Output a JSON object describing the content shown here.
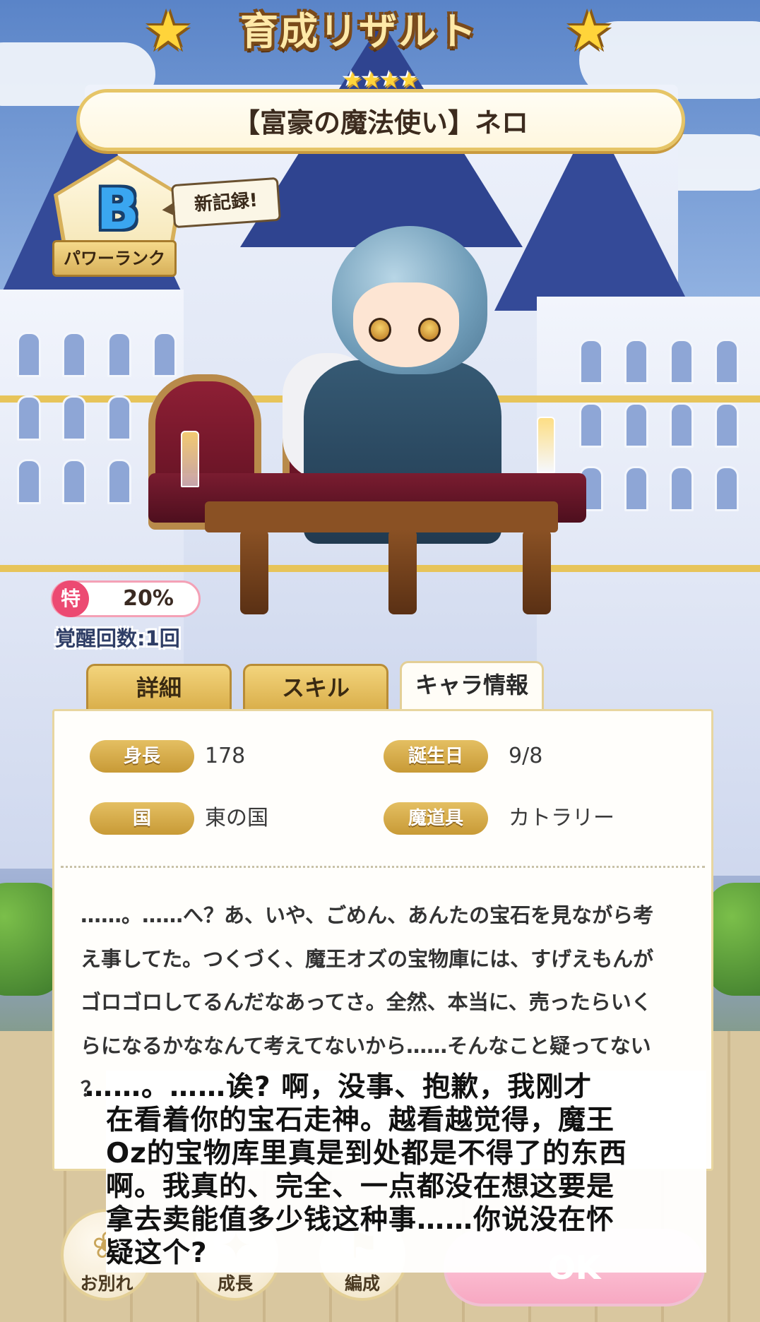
{
  "header": {
    "title": "育成リザルト",
    "star_left": "★",
    "star_right": "★",
    "rarity_stars": "★★★★",
    "card_name": "【富豪の魔法使い】ネロ"
  },
  "power_rank": {
    "rank": "B",
    "label": "パワーランク",
    "new_record": "新記録!"
  },
  "special": {
    "icon_label": "特",
    "value": "20%",
    "awakening": "覚醒回数:1回"
  },
  "tabs": [
    {
      "label": "詳細",
      "active": false
    },
    {
      "label": "スキル",
      "active": false
    },
    {
      "label": "キャラ情報",
      "active": true
    }
  ],
  "profile": {
    "fields": [
      {
        "label": "身長",
        "value": "178"
      },
      {
        "label": "誕生日",
        "value": "9/8"
      },
      {
        "label": "国",
        "value": "東の国"
      },
      {
        "label": "魔道具",
        "value": "カトラリー"
      }
    ],
    "text_lines": [
      "……。……へ？あ、いや、ごめん、あんたの宝石を見ながら考",
      "え事してた。つくづく、魔王オズの宝物庫には、すげえもんが",
      "ゴロゴロしてるんだなあってさ。全然、本当に、売ったらいく",
      "らになるかななんて考えてないから……そんなこと疑ってない",
      "？"
    ]
  },
  "translation": {
    "lines": [
      "……。……诶? 啊，没事、抱歉，我刚才",
      "在看着你的宝石走神。越看越觉得，魔王",
      "Oz的宝物库里真是到处都是不得了的东西",
      "啊。我真的、完全、一点都没在想这要是",
      "拿去卖能值多少钱这种事……你说没在怀",
      "疑这个?"
    ]
  },
  "buttons": {
    "farewell": "お別れ",
    "growth": "成長",
    "formation": "編成",
    "ok": "OK"
  },
  "colors": {
    "gold": "#d9ae4a",
    "pink_accent": "#ec4a72",
    "rank_blue": "#3aa6f0",
    "ok_pink": "#f7a8c2"
  }
}
